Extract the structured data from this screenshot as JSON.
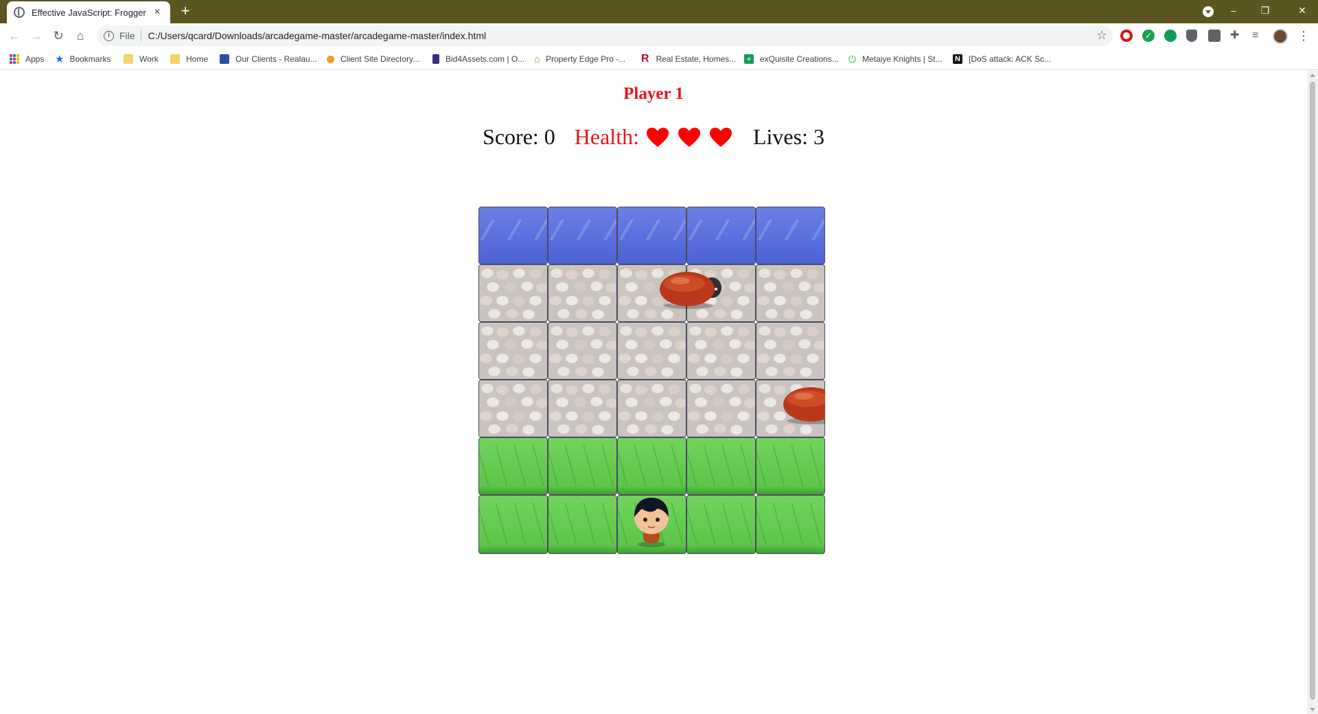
{
  "browser": {
    "tab_title": "Effective JavaScript: Frogger",
    "tab_close": "×",
    "new_tab": "+",
    "file_label": "File",
    "url": "C:/Users/qcard/Downloads/arcadegame-master/arcadegame-master/index.html",
    "window_controls": {
      "minimize": "–",
      "restore": "❐",
      "close": "✕"
    },
    "bookmarks": [
      {
        "label": "Apps",
        "icon": "apps-grid-icon"
      },
      {
        "label": "Bookmarks",
        "icon": "star-icon",
        "color": "#1a73e8"
      },
      {
        "label": "Work",
        "icon": "folder-icon",
        "color": "#f5d36a"
      },
      {
        "label": "Home",
        "icon": "folder-icon",
        "color": "#f5d36a"
      },
      {
        "label": "Our Clients - Realau...",
        "icon": "site-icon",
        "color": "#2b4fa3"
      },
      {
        "label": "Client Site Directory...",
        "icon": "site-icon",
        "color": "#f0a020"
      },
      {
        "label": "Bid4Assets.com | O...",
        "icon": "site-icon",
        "color": "#3a2a7a"
      },
      {
        "label": "Property Edge Pro -...",
        "icon": "house-icon",
        "color": "#6bb04a"
      },
      {
        "label": "Real Estate, Homes...",
        "icon": "r-logo-icon",
        "color": "#d0021b"
      },
      {
        "label": "exQuisite Creations...",
        "icon": "plus-icon",
        "color": "#0f9d58"
      },
      {
        "label": "Metaiye Knights | St...",
        "icon": "power-icon",
        "color": "#2fb04a"
      },
      {
        "label": "[DoS attack: ACK Sc...",
        "icon": "n-logo-icon",
        "color": "#111111"
      }
    ]
  },
  "game": {
    "player_title": "Player 1",
    "score_label": "Score: 0",
    "health_label": "Health:",
    "health_hearts": 3,
    "lives_label": "Lives: 3",
    "heart_color": "#ff0000",
    "title_color": "#e8141b",
    "board_rows": [
      "water",
      "stone",
      "stone",
      "stone",
      "grass",
      "grass"
    ],
    "board_cols": 5
  }
}
